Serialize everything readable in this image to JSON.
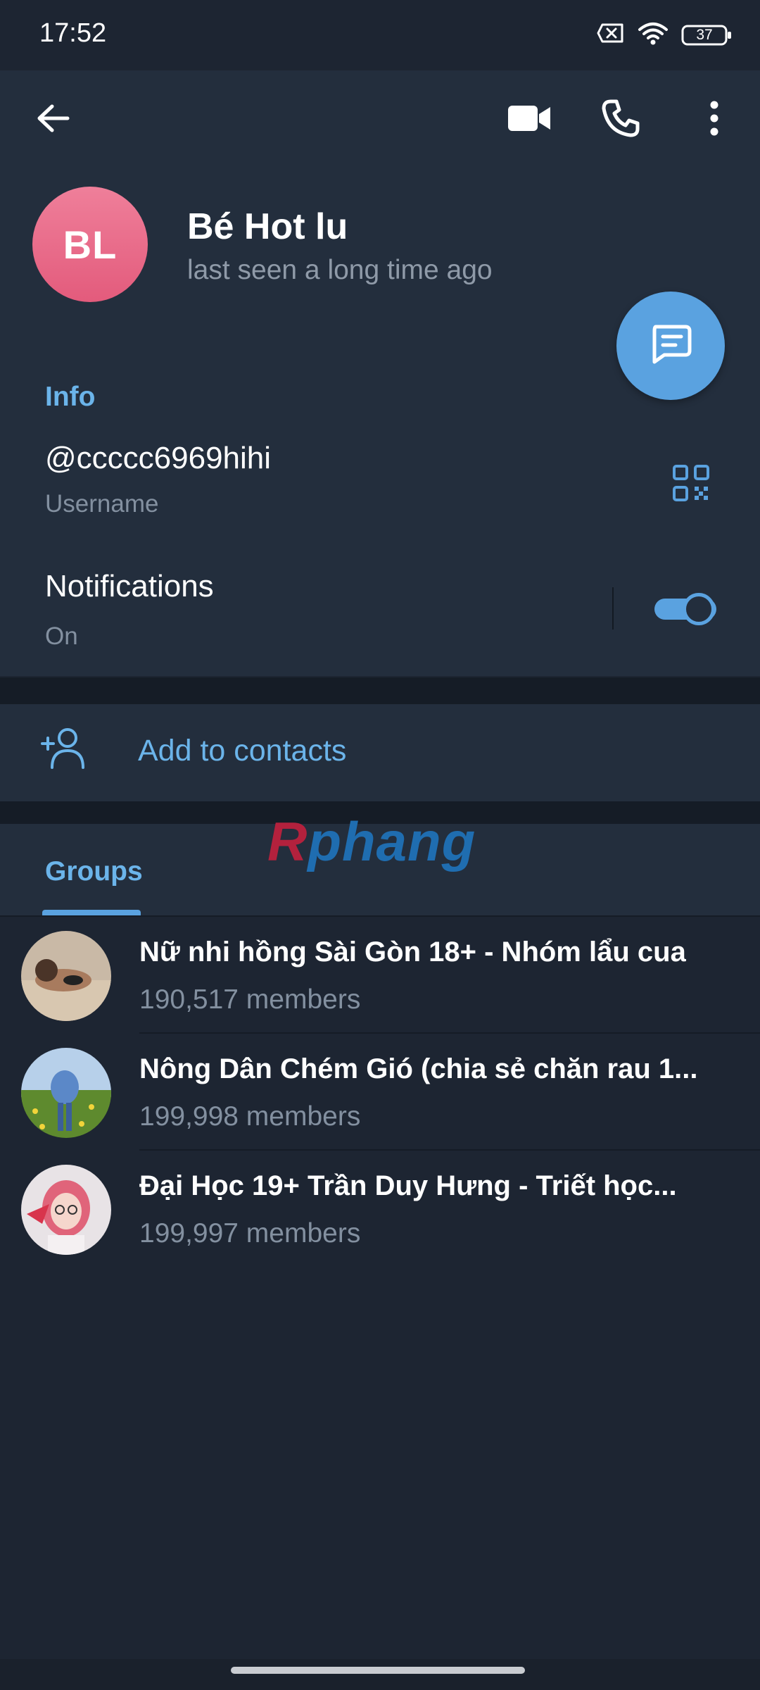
{
  "status_bar": {
    "time": "17:52",
    "battery": "37",
    "icons": [
      "no-sim-icon",
      "wifi-icon",
      "battery-icon"
    ]
  },
  "toolbar": {
    "icons": [
      "back-arrow-icon",
      "video-call-icon",
      "phone-icon",
      "more-vertical-icon"
    ]
  },
  "profile": {
    "initials": "BL",
    "name": "Bé Hot lu",
    "status": "last seen a long time ago",
    "avatar_color": "#e86584"
  },
  "info": {
    "title": "Info",
    "username": "@ccccc6969hihi",
    "username_label": "Username",
    "notifications_title": "Notifications",
    "notifications_value": "On",
    "notifications_enabled": true
  },
  "contacts": {
    "add_label": "Add to contacts"
  },
  "watermark": {
    "first": "R",
    "rest": "phang"
  },
  "groups": {
    "tab_label": "Groups",
    "items": [
      {
        "name": "Nữ nhi hồng Sài Gòn 18+ - Nhóm lẩu cua",
        "members": "190,517 members"
      },
      {
        "name": "Nông Dân Chém Gió (chia sẻ chăn rau 1...",
        "members": "199,998 members"
      },
      {
        "name": "Đại Học 19+ Trần Duy Hưng - Triết học...",
        "members": "199,997 members"
      }
    ]
  },
  "colors": {
    "background": "#1d2532",
    "surface": "#232e3d",
    "accent": "#5aa2e0",
    "accent_text": "#6bb4ea",
    "secondary_text": "#8390a0"
  }
}
